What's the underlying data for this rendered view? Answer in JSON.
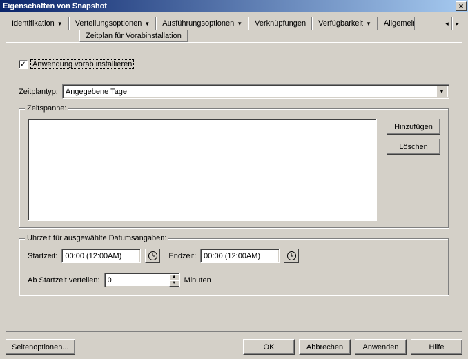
{
  "title": "Eigenschaften von Snapshot",
  "tabs": {
    "identifikation": "Identifikation",
    "verteilungsoptionen": "Verteilungsoptionen",
    "ausfuehrungsoptionen": "Ausführungsoptionen",
    "verknuepfungen": "Verknüpfungen",
    "verfuegbarkeit": "Verfügbarkeit",
    "allgemein": "Allgemein"
  },
  "subtab": "Zeitplan für Vorabinstallation",
  "checkbox": {
    "label": "Anwendung vorab installieren",
    "checked": "✓"
  },
  "zeitplantyp": {
    "label": "Zeitplantyp:",
    "value": "Angegebene Tage"
  },
  "zeitspanne": {
    "title": "Zeitspanne:",
    "hinzufuegen": "Hinzufügen",
    "loeschen": "Löschen"
  },
  "uhrzeit": {
    "title": "Uhrzeit für ausgewählte Datumsangaben:",
    "startzeit_label": "Startzeit:",
    "startzeit_value": "00:00 (12:00AM)",
    "endzeit_label": "Endzeit:",
    "endzeit_value": "00:00 (12:00AM)",
    "verteilen_label": "Ab Startzeit verteilen:",
    "verteilen_value": "0",
    "minuten": "Minuten"
  },
  "buttons": {
    "seitenoptionen": "Seitenoptionen...",
    "ok": "OK",
    "abbrechen": "Abbrechen",
    "anwenden": "Anwenden",
    "hilfe": "Hilfe"
  }
}
